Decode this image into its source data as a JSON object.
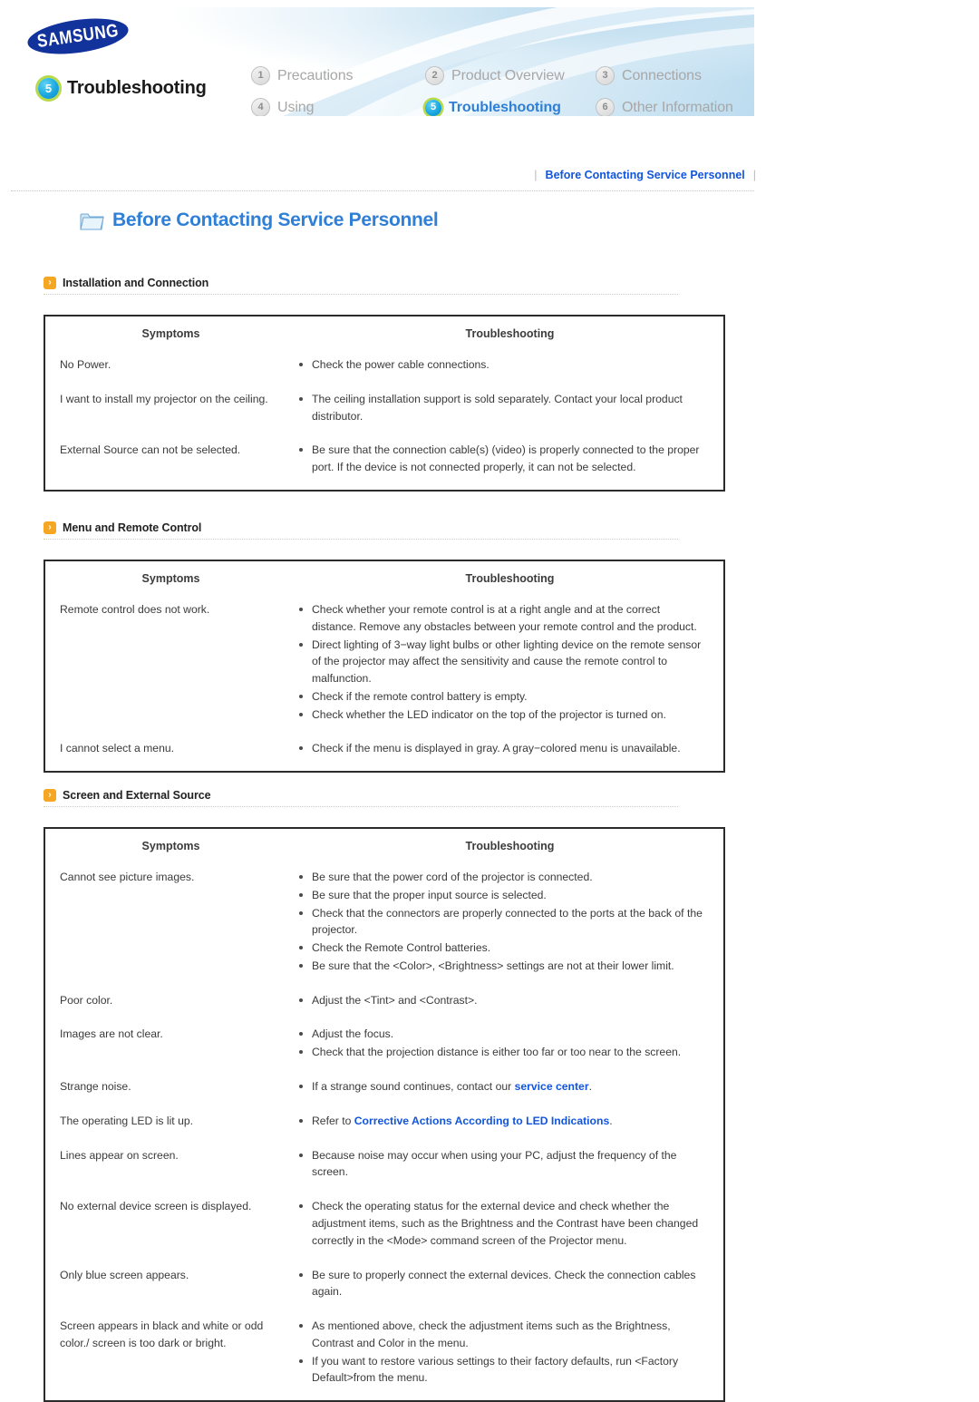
{
  "banner": {
    "brand": "SAMSUNG",
    "active_section_number": "5",
    "active_section_title": "Troubleshooting",
    "nav": [
      {
        "num": "1",
        "label": "Precautions",
        "active": false
      },
      {
        "num": "2",
        "label": "Product Overview",
        "active": false
      },
      {
        "num": "3",
        "label": "Connections",
        "active": false
      },
      {
        "num": "4",
        "label": "Using",
        "active": false
      },
      {
        "num": "5",
        "label": "Troubleshooting",
        "active": true
      },
      {
        "num": "6",
        "label": "Other Information",
        "active": false
      }
    ]
  },
  "breadcrumb": {
    "separator_left": "|",
    "label": "Before Contacting Service Personnel",
    "separator_right": "|"
  },
  "page_title": {
    "icon": "folder-icon",
    "text": "Before Contacting Service Personnel"
  },
  "table_headers": {
    "symptoms": "Symptoms",
    "troubleshooting": "Troubleshooting"
  },
  "sections": [
    {
      "title": "Installation and Connection",
      "rows": [
        {
          "symptom": "No Power.",
          "fixes": [
            [
              {
                "t": "Check the power cable connections."
              }
            ]
          ]
        },
        {
          "symptom": "I want to install my projector on the ceiling.",
          "fixes": [
            [
              {
                "t": "The ceiling installation support is sold separately. Contact your local product distributor."
              }
            ]
          ]
        },
        {
          "symptom": "External Source can not be selected.",
          "fixes": [
            [
              {
                "t": "Be sure that the connection cable(s) (video) is properly connected to the proper port. If the device is not connected properly, it can not be selected."
              }
            ]
          ]
        }
      ]
    },
    {
      "title": "Menu and Remote Control",
      "rows": [
        {
          "symptom": "Remote control does not work.",
          "fixes": [
            [
              {
                "t": "Check whether your remote control is at a right angle and at the correct distance. Remove any obstacles between your remote control and the product."
              }
            ],
            [
              {
                "t": "Direct lighting of 3−way light bulbs or other lighting device on the remote sensor of the projector may affect the sensitivity and cause the remote control to malfunction."
              }
            ],
            [
              {
                "t": "Check if the remote control battery is empty."
              }
            ],
            [
              {
                "t": "Check whether the LED indicator on the top of the projector is turned on."
              }
            ]
          ]
        },
        {
          "symptom": "I cannot select a menu.",
          "fixes": [
            [
              {
                "t": "Check if the menu is displayed in gray. A gray−colored menu is unavailable."
              }
            ]
          ]
        }
      ]
    },
    {
      "title": "Screen and External Source",
      "rows": [
        {
          "symptom": "Cannot see picture images.",
          "fixes": [
            [
              {
                "t": "Be sure that the power cord of the projector is connected."
              }
            ],
            [
              {
                "t": "Be sure that the proper input source is selected."
              }
            ],
            [
              {
                "t": "Check that the connectors are properly connected to the ports at the back of the projector."
              }
            ],
            [
              {
                "t": "Check the Remote Control batteries."
              }
            ],
            [
              {
                "t": "Be sure that the <Color>, <Brightness> settings are not at their lower limit."
              }
            ]
          ]
        },
        {
          "symptom": "Poor color.",
          "fixes": [
            [
              {
                "t": "Adjust the <Tint> and <Contrast>."
              }
            ]
          ]
        },
        {
          "symptom": "Images are not clear.",
          "fixes": [
            [
              {
                "t": "Adjust the focus."
              }
            ],
            [
              {
                "t": "Check that the projection distance is either too far or too near to the screen."
              }
            ]
          ]
        },
        {
          "symptom": "Strange noise.",
          "fixes": [
            [
              {
                "t": "If a strange sound continues, contact our "
              },
              {
                "t": "service center",
                "link": true
              },
              {
                "t": "."
              }
            ]
          ]
        },
        {
          "symptom": "The operating LED is lit up.",
          "fixes": [
            [
              {
                "t": "Refer to "
              },
              {
                "t": "Corrective Actions According to LED Indications",
                "link": true
              },
              {
                "t": "."
              }
            ]
          ]
        },
        {
          "symptom": "Lines appear on screen.",
          "fixes": [
            [
              {
                "t": "Because noise may occur when using your PC, adjust the frequency of the screen."
              }
            ]
          ]
        },
        {
          "symptom": "No external device screen is displayed.",
          "fixes": [
            [
              {
                "t": "Check the operating status for the external device and check whether the adjustment items, such as the Brightness and the Contrast have been changed correctly in the <Mode> command screen of the Projector menu."
              }
            ]
          ]
        },
        {
          "symptom": "Only blue screen appears.",
          "fixes": [
            [
              {
                "t": "Be sure to properly connect the external devices. Check the connection cables again."
              }
            ]
          ]
        },
        {
          "symptom": "Screen appears in black and white or odd color./ screen is too dark or bright.",
          "fixes": [
            [
              {
                "t": "As mentioned above, check the adjustment items such as the Brightness, Contrast and Color in the menu."
              }
            ],
            [
              {
                "t": "If you want to restore various settings to their factory defaults, run <Factory Default>from the menu."
              }
            ]
          ]
        }
      ]
    }
  ],
  "colors": {
    "link_blue": "#1155dd",
    "title_blue": "#2f7fd6",
    "accent_orange": "#f5a623",
    "samsung_navy": "#12329c",
    "underline_green": "#c9dd7a"
  }
}
